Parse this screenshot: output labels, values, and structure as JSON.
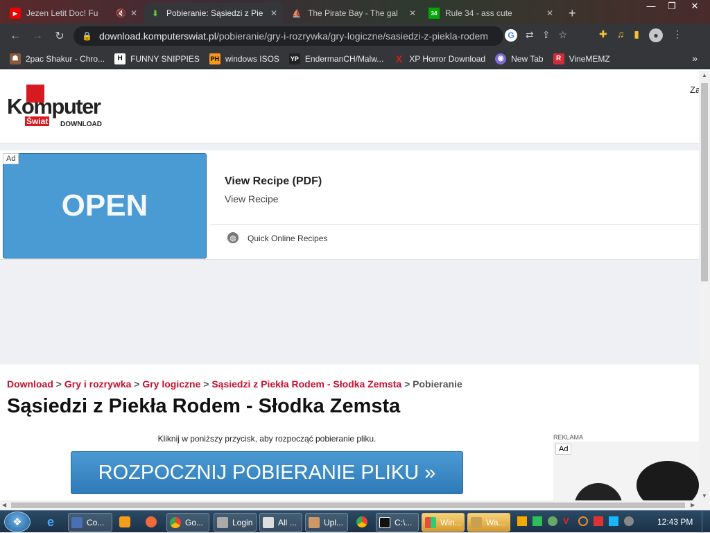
{
  "browser": {
    "tabs": [
      {
        "title": "Jezen Letit Doc! Fu",
        "favicon": "youtube-icon"
      },
      {
        "title": "Pobieranie: Sąsiedzi z Pie",
        "favicon": "download-arrow-icon"
      },
      {
        "title": "The Pirate Bay - The gal",
        "favicon": "pirate-ship-icon"
      },
      {
        "title": "Rule 34 - ass cute",
        "favicon": "rule34-icon"
      }
    ],
    "url_host": "download.komputerswiat.pl",
    "url_path": "/pobieranie/gry-i-rozrywka/gry-logiczne/sasiedzi-z-piekla-rodem",
    "bookmarks": [
      {
        "label": "2pac Shakur - Chro...",
        "icon": "tupac-icon",
        "color": "#c0392b"
      },
      {
        "label": "FUNNY SNIPPIES",
        "icon": "H",
        "color": "#ffffff"
      },
      {
        "label": "windows ISOS",
        "icon": "PH",
        "color": "#f7971d"
      },
      {
        "label": "EndermanCH/Malw...",
        "icon": "YP",
        "color": "#444444"
      },
      {
        "label": "XP Horror Download",
        "icon": "X",
        "color": "#d21f1f"
      },
      {
        "label": "New Tab",
        "icon": "globe-icon",
        "color": "#7e6bd4"
      },
      {
        "label": "VineMEMZ",
        "icon": "R",
        "color": "#d22c3a"
      }
    ],
    "bookmarks_more": "»"
  },
  "site": {
    "logo_main": "Komputer",
    "logo_swiat": "Świat",
    "logo_sub": "DOWNLOAD",
    "header_right": "Za",
    "ad": {
      "badge": "Ad",
      "open_button": "OPEN",
      "title": "View Recipe (PDF)",
      "subtitle": "View Recipe",
      "source": "Quick Online Recipes"
    },
    "breadcrumbs": [
      "Download",
      "Gry i rozrywka",
      "Gry logiczne",
      "Sąsiedzi z Piekła Rodem - Słodka Zemsta"
    ],
    "breadcrumb_current": "Pobieranie",
    "breadcrumb_sep": ">",
    "page_title": "Sąsiedzi z Piekła Rodem - Słodka Zemsta",
    "instruction": "Kliknij w poniższy przycisk, aby rozpocząć pobieranie pliku.",
    "download_button": "ROZPOCZNIJ POBIERANIE PLIKU »",
    "side_ad_label": "REKLAMA",
    "side_ad_badge": "Ad"
  },
  "colors": {
    "breadcrumb_link": "#c8102e",
    "download_button": "#3d8cc8",
    "ad_open": "#4a9ad4"
  },
  "taskbar": {
    "tasks": [
      {
        "label": "Co...",
        "icon": "program-icon"
      },
      {
        "label": "Go...",
        "icon": "chrome-icon"
      },
      {
        "label": "Login",
        "icon": "login-icon"
      },
      {
        "label": "All ...",
        "icon": "folder-icon"
      },
      {
        "label": "Upl...",
        "icon": "upload-icon"
      },
      {
        "label": "C:\\...",
        "icon": "7zip-icon"
      },
      {
        "label": "Win...",
        "icon": "windows-icon"
      },
      {
        "label": "Wa...",
        "icon": "warning-icon"
      }
    ],
    "clock": "12:43 PM"
  }
}
